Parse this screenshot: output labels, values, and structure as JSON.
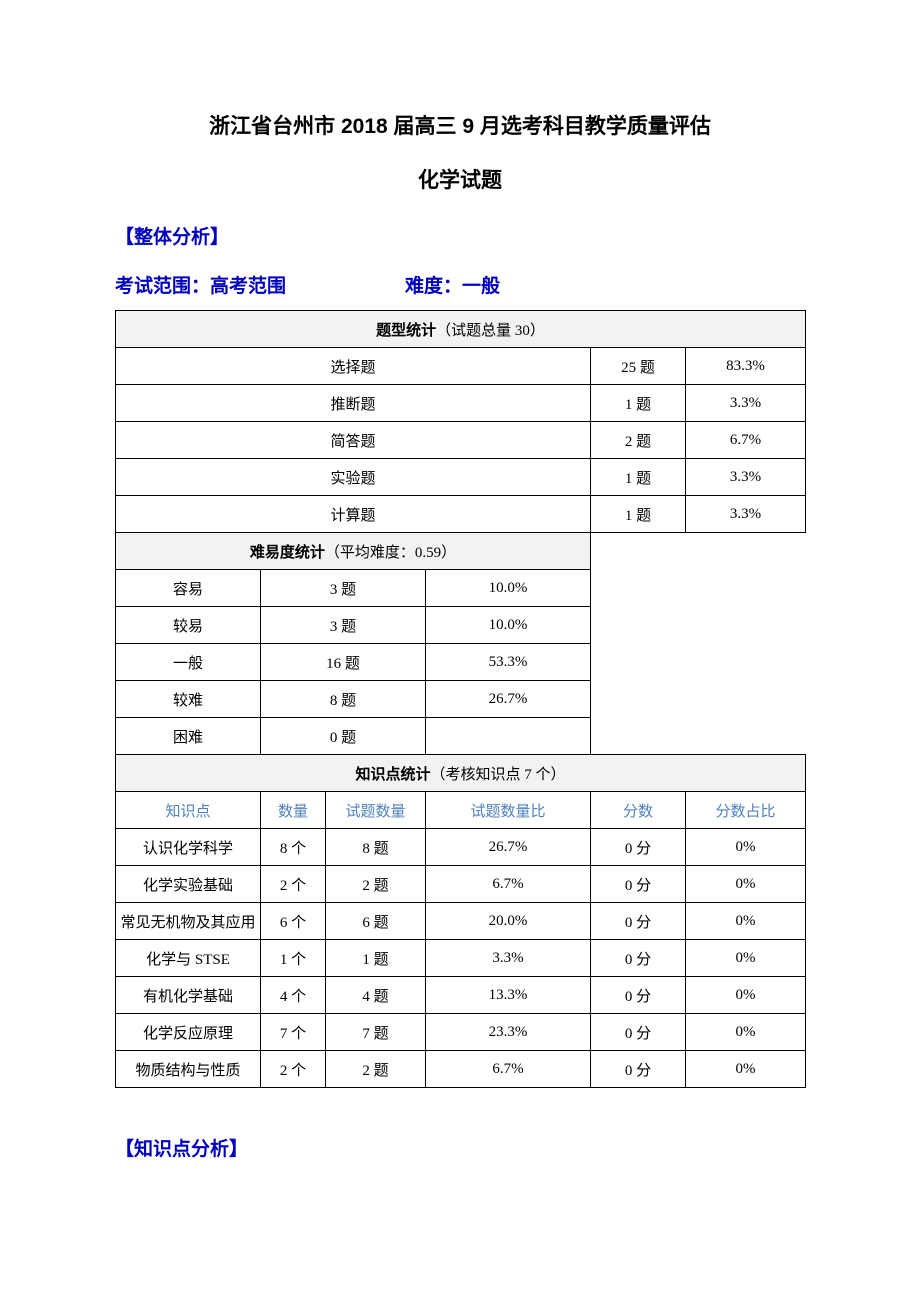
{
  "title_main": "浙江省台州市 2018 届高三 9 月选考科目教学质量评估",
  "title_sub": "化学试题",
  "section_overall": "【整体分析】",
  "scope": {
    "label": "考试范围：",
    "value": "高考范围",
    "difficulty_label": "难度：",
    "difficulty_value": "一般"
  },
  "type_stats": {
    "header_bold": "题型统计",
    "header_reg": "（试题总量 30）",
    "rows": [
      {
        "name": "选择题",
        "count": "25 题",
        "pct": "83.3%"
      },
      {
        "name": "推断题",
        "count": "1 题",
        "pct": "3.3%"
      },
      {
        "name": "简答题",
        "count": "2 题",
        "pct": "6.7%"
      },
      {
        "name": "实验题",
        "count": "1 题",
        "pct": "3.3%"
      },
      {
        "name": "计算题",
        "count": "1 题",
        "pct": "3.3%"
      }
    ]
  },
  "difficulty_stats": {
    "header_bold": "难易度统计",
    "header_reg": "（平均难度：0.59）",
    "rows": [
      {
        "name": "容易",
        "count": "3 题",
        "pct": "10.0%"
      },
      {
        "name": "较易",
        "count": "3 题",
        "pct": "10.0%"
      },
      {
        "name": "一般",
        "count": "16 题",
        "pct": "53.3%"
      },
      {
        "name": "较难",
        "count": "8 题",
        "pct": "26.7%"
      },
      {
        "name": "困难",
        "count": "0 题",
        "pct": ""
      }
    ]
  },
  "knowledge_stats": {
    "header_bold": "知识点统计",
    "header_reg": "（考核知识点 7 个）",
    "cols": {
      "c1": "知识点",
      "c2": "数量",
      "c3": "试题数量",
      "c4": "试题数量比",
      "c5": "分数",
      "c6": "分数占比"
    },
    "rows": [
      {
        "c1": "认识化学科学",
        "c2": "8 个",
        "c3": "8 题",
        "c4": "26.7%",
        "c5": "0 分",
        "c6": "0%"
      },
      {
        "c1": "化学实验基础",
        "c2": "2 个",
        "c3": "2 题",
        "c4": "6.7%",
        "c5": "0 分",
        "c6": "0%"
      },
      {
        "c1": "常见无机物及其应用",
        "c2": "6 个",
        "c3": "6 题",
        "c4": "20.0%",
        "c5": "0 分",
        "c6": "0%"
      },
      {
        "c1": "化学与 STSE",
        "c2": "1 个",
        "c3": "1 题",
        "c4": "3.3%",
        "c5": "0 分",
        "c6": "0%"
      },
      {
        "c1": "有机化学基础",
        "c2": "4 个",
        "c3": "4 题",
        "c4": "13.3%",
        "c5": "0 分",
        "c6": "0%"
      },
      {
        "c1": "化学反应原理",
        "c2": "7 个",
        "c3": "7 题",
        "c4": "23.3%",
        "c5": "0 分",
        "c6": "0%"
      },
      {
        "c1": "物质结构与性质",
        "c2": "2 个",
        "c3": "2 题",
        "c4": "6.7%",
        "c5": "0 分",
        "c6": "0%"
      }
    ]
  },
  "section_knowledge": "【知识点分析】"
}
